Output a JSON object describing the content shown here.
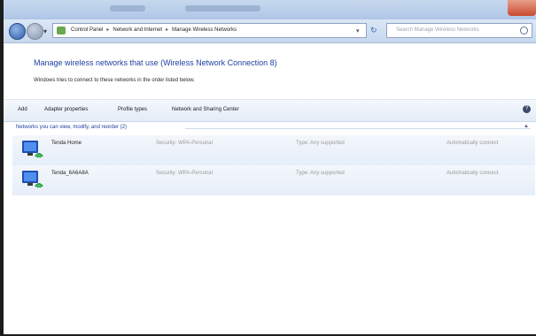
{
  "window": {
    "address": {
      "segments": [
        "Control Panel",
        "Network and Internet",
        "Manage Wireless Networks"
      ],
      "separator": "▸"
    },
    "search": {
      "placeholder": "Search Manage Wireless Networks"
    }
  },
  "page": {
    "heading": "Manage wireless networks that use (Wireless Network Connection 8)",
    "subtext": "Windows tries to connect to these networks in the order listed below."
  },
  "toolbar": {
    "add": "Add",
    "adapter_properties": "Adapter properties",
    "profile_types": "Profile types",
    "network_sharing": "Network and Sharing Center",
    "help": "?"
  },
  "group": {
    "header": "Networks you can view, modify, and reorder (2)"
  },
  "networks": [
    {
      "name": "Tenda Home",
      "security": "Security: WPA-Personal",
      "type": "Type: Any supported",
      "mode": "Automatically connect"
    },
    {
      "name": "Tenda_6A6A8A",
      "security": "Security: WPA-Personal",
      "type": "Type: Any supported",
      "mode": "Automatically connect"
    }
  ],
  "colors": {
    "accent": "#1e3fa0",
    "toolbar": "#e3ecf7",
    "selected_row": "#e6eef8"
  }
}
